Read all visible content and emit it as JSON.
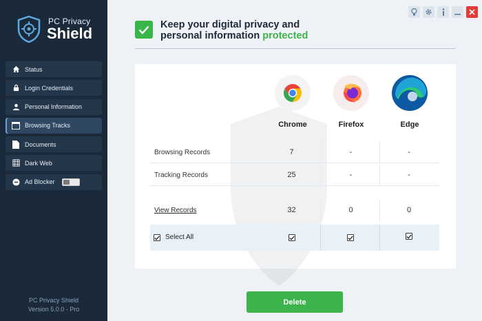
{
  "app": {
    "logo_line1": "PC Privacy",
    "logo_line2": "Shield"
  },
  "sidebar": {
    "items": [
      {
        "label": "Status",
        "icon": "home-icon"
      },
      {
        "label": "Login Credentials",
        "icon": "lock-icon"
      },
      {
        "label": "Personal Information",
        "icon": "user-icon"
      },
      {
        "label": "Browsing Tracks",
        "icon": "browser-window-icon",
        "active": true
      },
      {
        "label": "Documents",
        "icon": "document-icon"
      },
      {
        "label": "Dark Web",
        "icon": "globe-icon"
      },
      {
        "label": "Ad Blocker",
        "icon": "block-icon",
        "toggle": "off"
      }
    ],
    "footer_line1": "PC Privacy Shield",
    "footer_line2": "Version 5.0.0 - Pro"
  },
  "window_buttons": [
    "bulb-icon",
    "gear-icon",
    "info-icon",
    "minimize-icon",
    "close-icon"
  ],
  "header": {
    "line1": "Keep your digital privacy and",
    "line2_prefix": "personal information ",
    "line2_highlight": "protected"
  },
  "browsers": {
    "chrome": "Chrome",
    "firefox": "Firefox",
    "edge": "Edge"
  },
  "rows": {
    "browsing": {
      "label": "Browsing Records",
      "chrome": "7",
      "firefox": "-",
      "edge": "-"
    },
    "tracking": {
      "label": "Tracking Records",
      "chrome": "25",
      "firefox": "-",
      "edge": "-"
    },
    "view": {
      "label": "View Records",
      "chrome": "32",
      "firefox": "0",
      "edge": "0"
    }
  },
  "select_all": {
    "label": "Select All",
    "checked": true
  },
  "actions": {
    "delete": "Delete"
  },
  "colors": {
    "sidebar_bg": "#1b2a3a",
    "accent_green": "#3cb44b",
    "close_red": "#e43a3a"
  }
}
